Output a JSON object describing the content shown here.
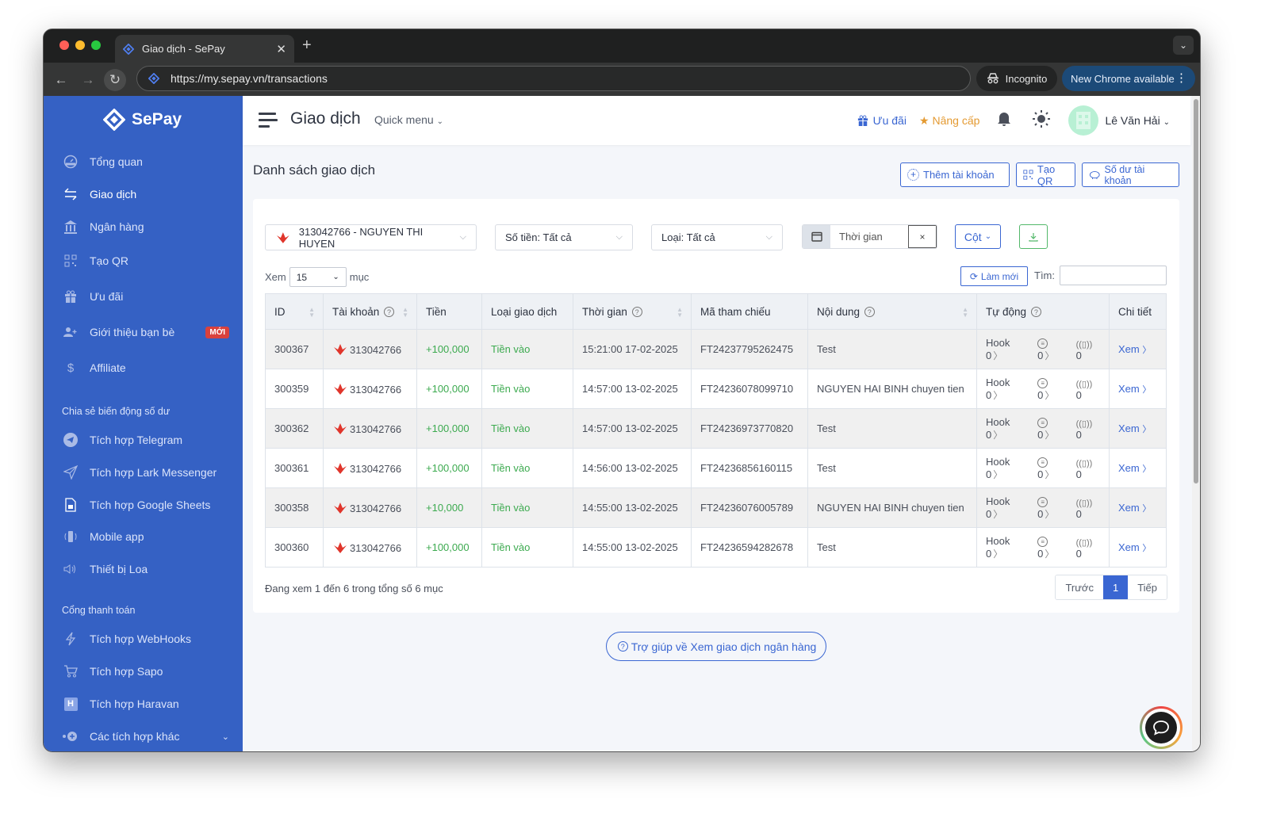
{
  "browser": {
    "tab_title": "Giao dịch - SePay",
    "url": "https://my.sepay.vn/transactions",
    "incognito_label": "Incognito",
    "update_label": "New Chrome available"
  },
  "sidebar": {
    "brand": "SePay",
    "items": [
      {
        "label": "Tổng quan",
        "icon": "dashboard-icon"
      },
      {
        "label": "Giao dịch",
        "icon": "transfer-icon",
        "active": true
      },
      {
        "label": "Ngân hàng",
        "icon": "bank-icon"
      },
      {
        "label": "Tạo QR",
        "icon": "qr-icon"
      },
      {
        "label": "Ưu đãi",
        "icon": "gift-icon"
      },
      {
        "label": "Giới thiệu bạn bè",
        "icon": "user-plus-icon",
        "badge": "MỚI"
      },
      {
        "label": "Affiliate",
        "icon": "dollar-icon"
      }
    ],
    "section_share": "Chia sẻ biến động số dư",
    "share_items": [
      {
        "label": "Tích hợp Telegram",
        "icon": "telegram-icon"
      },
      {
        "label": "Tích hợp Lark Messenger",
        "icon": "send-icon"
      },
      {
        "label": "Tích hợp Google Sheets",
        "icon": "sheet-icon"
      },
      {
        "label": "Mobile app",
        "icon": "mobile-icon"
      },
      {
        "label": "Thiết bị Loa",
        "icon": "speaker-icon"
      }
    ],
    "section_gateway": "Cổng thanh toán",
    "gateway_items": [
      {
        "label": "Tích hợp WebHooks",
        "icon": "lightning-icon"
      },
      {
        "label": "Tích hợp Sapo",
        "icon": "cart-icon"
      },
      {
        "label": "Tích hợp Haravan",
        "icon": "haravan-icon"
      },
      {
        "label": "Các tích hợp khác",
        "icon": "plus-circle-icon"
      }
    ]
  },
  "header": {
    "title": "Giao dịch",
    "quick_menu": "Quick menu",
    "promo": "Ưu đãi",
    "upgrade": "Nâng cấp",
    "user_name": "Lê Văn Hải"
  },
  "page": {
    "title": "Danh sách giao dịch",
    "add_account": "Thêm tài khoản",
    "create_qr": "Tạo QR",
    "balance": "Số dư tài khoản"
  },
  "filters": {
    "account": "313042766 - NGUYEN THI HUYEN",
    "amount": "Số tiền: Tất cả",
    "type": "Loại: Tất cả",
    "time_placeholder": "Thời gian",
    "clear": "×",
    "columns": "Cột"
  },
  "table_controls": {
    "show_prefix": "Xem",
    "page_size": "15",
    "show_suffix": "mục",
    "refresh": "Làm mới",
    "search_label": "Tìm:",
    "search_value": ""
  },
  "table": {
    "columns": [
      "ID",
      "Tài khoản",
      "Tiền",
      "Loại giao dịch",
      "Thời gian",
      "Mã tham chiếu",
      "Nội dung",
      "Tự động",
      "Chi tiết"
    ],
    "rows": [
      {
        "id": "300367",
        "account": "313042766",
        "amount": "+100,000",
        "type": "Tiền vào",
        "time": "15:21:00 17-02-2025",
        "ref": "FT24237795262475",
        "content": "Test",
        "hook": "Hook 0",
        "msg": "0",
        "device": "0",
        "detail": "Xem"
      },
      {
        "id": "300359",
        "account": "313042766",
        "amount": "+100,000",
        "type": "Tiền vào",
        "time": "14:57:00 13-02-2025",
        "ref": "FT24236078099710",
        "content": "NGUYEN HAI BINH chuyen tien",
        "hook": "Hook 0",
        "msg": "0",
        "device": "0",
        "detail": "Xem"
      },
      {
        "id": "300362",
        "account": "313042766",
        "amount": "+100,000",
        "type": "Tiền vào",
        "time": "14:57:00 13-02-2025",
        "ref": "FT24236973770820",
        "content": "Test",
        "hook": "Hook 0",
        "msg": "0",
        "device": "0",
        "detail": "Xem"
      },
      {
        "id": "300361",
        "account": "313042766",
        "amount": "+100,000",
        "type": "Tiền vào",
        "time": "14:56:00 13-02-2025",
        "ref": "FT24236856160115",
        "content": "Test",
        "hook": "Hook 0",
        "msg": "0",
        "device": "0",
        "detail": "Xem"
      },
      {
        "id": "300358",
        "account": "313042766",
        "amount": "+10,000",
        "type": "Tiền vào",
        "time": "14:55:00 13-02-2025",
        "ref": "FT24236076005789",
        "content": "NGUYEN HAI BINH chuyen tien",
        "hook": "Hook 0",
        "msg": "0",
        "device": "0",
        "detail": "Xem"
      },
      {
        "id": "300360",
        "account": "313042766",
        "amount": "+100,000",
        "type": "Tiền vào",
        "time": "14:55:00 13-02-2025",
        "ref": "FT24236594282678",
        "content": "Test",
        "hook": "Hook 0",
        "msg": "0",
        "device": "0",
        "detail": "Xem"
      }
    ]
  },
  "footer": {
    "info": "Đang xem 1 đến 6 trong tổng số 6 mục",
    "prev": "Trước",
    "current_page": "1",
    "next": "Tiếp",
    "help": "Trợ giúp về Xem giao dịch ngân hàng"
  },
  "colors": {
    "primary": "#3a66d2",
    "sidebar": "#3561c4",
    "success": "#3caa4f",
    "upgrade": "#e49a32",
    "badge": "#d9413d",
    "bank_logo": "#e0352b"
  }
}
